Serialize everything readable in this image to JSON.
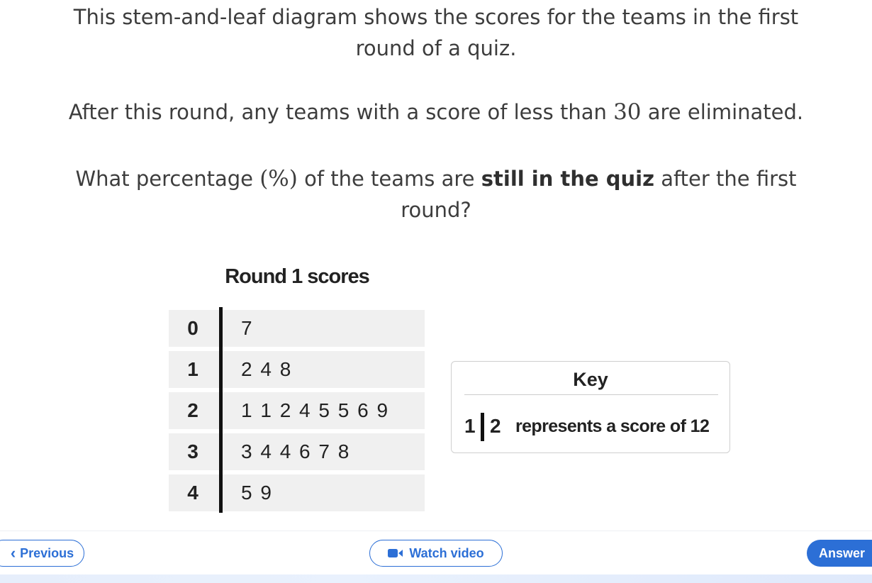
{
  "question": {
    "line1_a": "This stem-and-leaf diagram shows the scores for the teams in the first",
    "line1_b": "round of a quiz.",
    "line2_pre": "After this round, any teams with a score of less than ",
    "line2_num": "30",
    "line2_post": " are eliminated.",
    "line3_pre": "What percentage ",
    "line3_sym": "(%)",
    "line3_mid": " of the teams are ",
    "line3_bold": "still in the quiz",
    "line3_post": " after the first",
    "line3_b": "round?"
  },
  "stem_leaf": {
    "title": "Round 1 scores",
    "rows": [
      {
        "stem": "0",
        "leaves": "7"
      },
      {
        "stem": "1",
        "leaves": "2 4 8"
      },
      {
        "stem": "2",
        "leaves": "1 1 2 4 5 5 6 9"
      },
      {
        "stem": "3",
        "leaves": "3 4 4 6 7 8"
      },
      {
        "stem": "4",
        "leaves": "5 9"
      }
    ]
  },
  "key": {
    "title": "Key",
    "stem": "1",
    "leaf": "2",
    "text": "represents a score of 12"
  },
  "footer": {
    "previous_label": "Previous",
    "video_label": "Watch video",
    "answer_label": "Answer"
  },
  "colors": {
    "accent": "#2c6fd6",
    "row_bg": "#f0f0f0",
    "text": "#3d3d3d"
  },
  "icons": {
    "previous": "chevron-left-icon",
    "video": "video-camera-icon"
  }
}
